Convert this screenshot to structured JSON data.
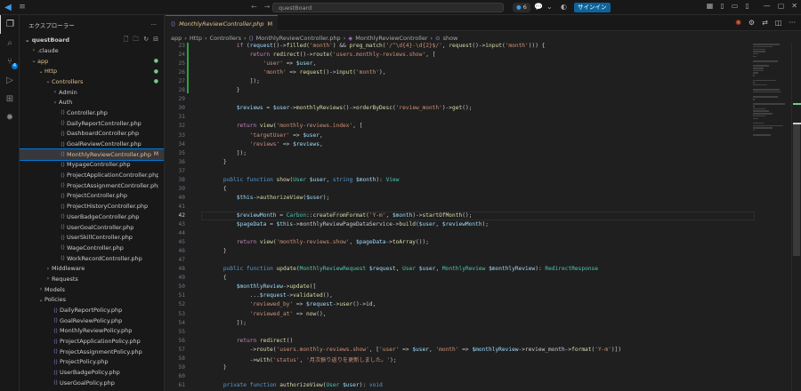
{
  "titlebar": {
    "search": "questBoard",
    "badge_count": "6",
    "signin": "サインイン"
  },
  "colors": {
    "accent": "#0078d4",
    "modified": "#e2c08d",
    "added": "#73c991"
  },
  "activity": {
    "scm_count": "4"
  },
  "sidebar": {
    "title": "エクスプローラー",
    "root": "questBoard",
    "items": [
      {
        "label": ".claude",
        "depth": 1,
        "folder": true,
        "open": false
      },
      {
        "label": "app",
        "depth": 1,
        "folder": true,
        "open": true,
        "orange": true,
        "mark": "●"
      },
      {
        "label": "Http",
        "depth": 2,
        "folder": true,
        "open": true,
        "orange": true,
        "mark": "●"
      },
      {
        "label": "Controllers",
        "depth": 3,
        "folder": true,
        "open": true,
        "orange": true,
        "mark": "●"
      },
      {
        "label": "Admin",
        "depth": 4,
        "folder": true,
        "open": false
      },
      {
        "label": "Auth",
        "depth": 4,
        "folder": true,
        "open": false
      },
      {
        "label": "Controller.php",
        "depth": 4
      },
      {
        "label": "DailyReportController.php",
        "depth": 4
      },
      {
        "label": "DashboardController.php",
        "depth": 4
      },
      {
        "label": "GoalReviewController.php",
        "depth": 4
      },
      {
        "label": "MonthlyReviewController.php",
        "depth": 4,
        "selected": true,
        "mark": "M"
      },
      {
        "label": "MypageController.php",
        "depth": 4
      },
      {
        "label": "ProjectApplicationController.php",
        "depth": 4
      },
      {
        "label": "ProjectAssignmentController.php",
        "depth": 4
      },
      {
        "label": "ProjectController.php",
        "depth": 4
      },
      {
        "label": "ProjectHistoryController.php",
        "depth": 4
      },
      {
        "label": "UserBadgeController.php",
        "depth": 4
      },
      {
        "label": "UserGoalController.php",
        "depth": 4
      },
      {
        "label": "UserSkillController.php",
        "depth": 4
      },
      {
        "label": "WageController.php",
        "depth": 4
      },
      {
        "label": "WorkRecordController.php",
        "depth": 4
      },
      {
        "label": "Middleware",
        "depth": 3,
        "folder": true,
        "open": false
      },
      {
        "label": "Requests",
        "depth": 3,
        "folder": true,
        "open": false
      },
      {
        "label": "Models",
        "depth": 2,
        "folder": true,
        "open": false
      },
      {
        "label": "Policies",
        "depth": 2,
        "folder": true,
        "open": true
      },
      {
        "label": "DailyReportPolicy.php",
        "depth": 3
      },
      {
        "label": "GoalReviewPolicy.php",
        "depth": 3
      },
      {
        "label": "MonthlyReviewPolicy.php",
        "depth": 3
      },
      {
        "label": "ProjectApplicationPolicy.php",
        "depth": 3
      },
      {
        "label": "ProjectAssignmentPolicy.php",
        "depth": 3
      },
      {
        "label": "ProjectPolicy.php",
        "depth": 3
      },
      {
        "label": "UserBadgePolicy.php",
        "depth": 3
      },
      {
        "label": "UserGoalPolicy.php",
        "depth": 3
      }
    ]
  },
  "tab": {
    "label": "MonthlyReviewController.php",
    "mark": "M"
  },
  "breadcrumb": [
    "app",
    "Http",
    "Controllers",
    "MonthlyReviewController.php",
    "MonthlyReviewController",
    "show"
  ],
  "editor": {
    "current_line": "42",
    "lines": [
      {
        "n": "23",
        "html": "        <span class='c'>if</span> (<span class='v'>request</span>()-><span class='f'>filled</span>(<span class='s'>'month'</span>) && <span class='f'>preg_match</span>(<span class='s'>'/^\\d{4}-\\d{2}$/'</span>, <span class='f'>request</span>()-><span class='f'>input</span>(<span class='s'>'month'</span>))) {"
      },
      {
        "n": "24",
        "html": "            <span class='c'>return</span> <span class='f'>redirect</span>()-><span class='f'>route</span>(<span class='s'>'users.monthly-reviews.show'</span>, ["
      },
      {
        "n": "25",
        "html": "                <span class='s'>'user'</span> => <span class='v'>$user</span>,"
      },
      {
        "n": "26",
        "html": "                <span class='s'>'month'</span> => <span class='f'>request</span>()-><span class='f'>input</span>(<span class='s'>'month'</span>),"
      },
      {
        "n": "27",
        "html": "            ]);"
      },
      {
        "n": "28",
        "html": "        }"
      },
      {
        "n": "29",
        "html": ""
      },
      {
        "n": "30",
        "html": "        <span class='v'>$reviews</span> = <span class='v'>$user</span>-><span class='f'>monthlyReviews</span>()-><span class='f'>orderByDesc</span>(<span class='s'>'review_month'</span>)-><span class='f'>get</span>();"
      },
      {
        "n": "31",
        "html": ""
      },
      {
        "n": "32",
        "html": "        <span class='c'>return</span> <span class='f'>view</span>(<span class='s'>'monthly-reviews.index'</span>, ["
      },
      {
        "n": "33",
        "html": "            <span class='s'>'targetUser'</span> => <span class='v'>$user</span>,"
      },
      {
        "n": "34",
        "html": "            <span class='s'>'reviews'</span> => <span class='v'>$reviews</span>,"
      },
      {
        "n": "35",
        "html": "        ]);"
      },
      {
        "n": "36",
        "html": "    }"
      },
      {
        "n": "37",
        "html": ""
      },
      {
        "n": "38",
        "html": "    <span class='k'>public</span> <span class='k'>function</span> <span class='f'>show</span>(<span class='t'>User</span> <span class='v'>$user</span>, <span class='k'>string</span> <span class='v'>$month</span>): <span class='t'>View</span>"
      },
      {
        "n": "39",
        "html": "    {"
      },
      {
        "n": "40",
        "html": "        <span class='v'>$this</span>-><span class='f'>authorizeView</span>(<span class='v'>$user</span>);"
      },
      {
        "n": "41",
        "html": ""
      },
      {
        "n": "42",
        "html": "        <span class='v'>$reviewMonth</span> = <span class='t'>Carbon</span>::<span class='f'>createFromFormat</span>(<span class='s'>'Y-m'</span>, <span class='v'>$month</span>)-><span class='f'>startOfMonth</span>();"
      },
      {
        "n": "43",
        "html": "        <span class='v'>$pageData</span> = <span class='v'>$this</span>->monthlyReviewPageDataService-><span class='f'>build</span>(<span class='v'>$user</span>, <span class='v'>$reviewMonth</span>);"
      },
      {
        "n": "44",
        "html": ""
      },
      {
        "n": "45",
        "html": "        <span class='c'>return</span> <span class='f'>view</span>(<span class='s'>'monthly-reviews.show'</span>, <span class='v'>$pageData</span>-><span class='f'>toArray</span>());"
      },
      {
        "n": "46",
        "html": "    }"
      },
      {
        "n": "47",
        "html": ""
      },
      {
        "n": "48",
        "html": "    <span class='k'>public</span> <span class='k'>function</span> <span class='f'>update</span>(<span class='t'>MonthlyReviewRequest</span> <span class='v'>$request</span>, <span class='t'>User</span> <span class='v'>$user</span>, <span class='t'>MonthlyReview</span> <span class='v'>$monthlyReview</span>): <span class='t'>RedirectResponse</span>"
      },
      {
        "n": "49",
        "html": "    {"
      },
      {
        "n": "50",
        "html": "        <span class='v'>$monthlyReview</span>-><span class='f'>update</span>(["
      },
      {
        "n": "51",
        "html": "            ...<span class='v'>$request</span>-><span class='f'>validated</span>(),"
      },
      {
        "n": "52",
        "html": "            <span class='s'>'reviewed_by'</span> => <span class='v'>$request</span>-><span class='f'>user</span>()->id,"
      },
      {
        "n": "53",
        "html": "            <span class='s'>'reviewed_at'</span> => <span class='f'>now</span>(),"
      },
      {
        "n": "54",
        "html": "        ]);"
      },
      {
        "n": "55",
        "html": ""
      },
      {
        "n": "56",
        "html": "        <span class='c'>return</span> <span class='f'>redirect</span>()"
      },
      {
        "n": "57",
        "html": "            -><span class='f'>route</span>(<span class='s'>'users.monthly-reviews.show'</span>, [<span class='s'>'user'</span> => <span class='v'>$user</span>, <span class='s'>'month'</span> => <span class='v'>$monthlyReview</span>->review_month-><span class='f'>format</span>(<span class='s'>'Y-m'</span>)])"
      },
      {
        "n": "58",
        "html": "            -><span class='f'>with</span>(<span class='s'>'status'</span>, <span class='s'>'月次振り返りを更新しました。'</span>);"
      },
      {
        "n": "59",
        "html": "    }"
      },
      {
        "n": "60",
        "html": ""
      },
      {
        "n": "61",
        "html": "    <span class='k'>private</span> <span class='k'>function</span> <span class='f'>authorizeView</span>(<span class='t'>User</span> <span class='v'>$user</span>): <span class='k'>void</span>"
      }
    ]
  }
}
